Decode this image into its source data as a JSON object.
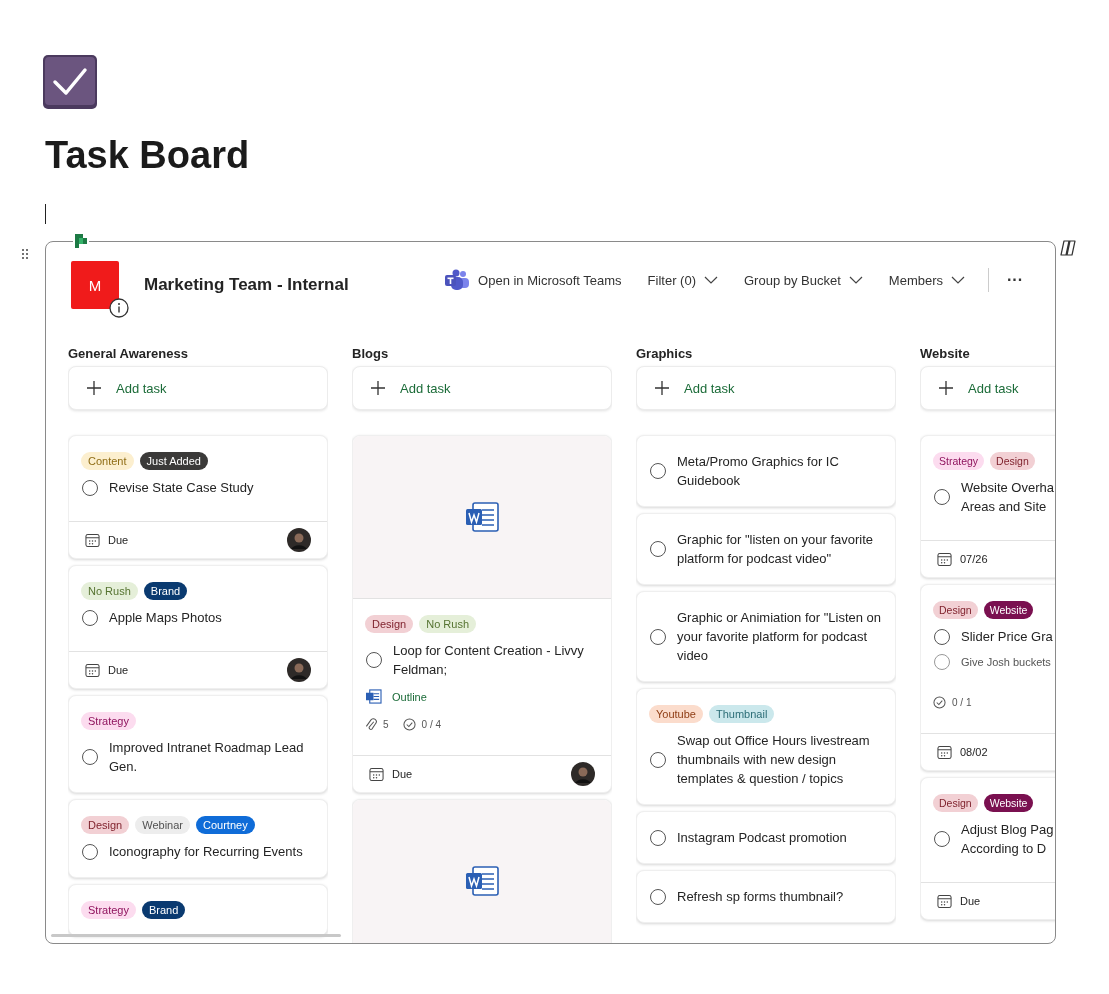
{
  "page": {
    "title": "Task Board"
  },
  "board": {
    "plan_initial": "M",
    "plan_name": "Marketing Team - Internal",
    "toolbar": [
      {
        "kind": "teams",
        "label": "Open in Microsoft Teams"
      },
      {
        "kind": "dropdown",
        "label": "Filter (0)"
      },
      {
        "kind": "dropdown",
        "label": "Group by Bucket"
      },
      {
        "kind": "dropdown",
        "label": "Members"
      }
    ],
    "more": "···",
    "columns": [
      {
        "name": "General Awareness",
        "add_label": "Add task",
        "cards": [
          {
            "tags": [
              {
                "label": "Content",
                "color": "#fcefcf"
              },
              {
                "label": "Just Added",
                "color": "#3b3a39"
              }
            ],
            "title": "Revise State Case Study",
            "done": false,
            "due": "Due",
            "assigned": true
          },
          {
            "tags": [
              {
                "label": "No Rush",
                "color": "#e5efd9"
              },
              {
                "label": "Brand",
                "color": "#0a3a70"
              }
            ],
            "title": "Apple Maps Photos",
            "done": false,
            "due": "Due",
            "assigned": true
          },
          {
            "tags": [
              {
                "label": "Strategy",
                "color": "#fcdcef"
              }
            ],
            "title": "Improved Intranet Roadmap Lead Gen.",
            "done": false
          },
          {
            "tags": [
              {
                "label": "Design",
                "color": "#f2d0d4"
              },
              {
                "label": "Webinar",
                "color": "#ededed"
              },
              {
                "label": "Courtney",
                "color": "#0f6cd8"
              }
            ],
            "title": "Iconography for Recurring Events",
            "done": false
          },
          {
            "tags": [
              {
                "label": "Strategy",
                "color": "#fcdcef"
              },
              {
                "label": "Brand",
                "color": "#0a3a70"
              }
            ]
          }
        ]
      },
      {
        "name": "Blogs",
        "add_label": "Add task",
        "cards": [
          {
            "preview": true,
            "tags": [
              {
                "label": "Design",
                "color": "#f2d0d4"
              },
              {
                "label": "No Rush",
                "color": "#e5efd9"
              }
            ],
            "title": "Loop for Content Creation - Livvy Feldman;",
            "done": false,
            "attachment": "Outline",
            "attachments_count": "5",
            "checklist_count": "0 / 4",
            "due": "Due",
            "assigned": true
          },
          {
            "preview": true
          }
        ]
      },
      {
        "name": "Graphics",
        "add_label": "Add task",
        "cards": [
          {
            "title": "Meta/Promo Graphics for IC Guidebook",
            "done": false
          },
          {
            "title": "Graphic for \"listen on your favorite platform for podcast video\"",
            "done": false
          },
          {
            "title": "Graphic or Animiation for \"Listen on your favorite platform for podcast video",
            "done": false
          },
          {
            "tags": [
              {
                "label": "Youtube",
                "color": "#fbdccc"
              },
              {
                "label": "Thumbnail",
                "color": "#cbe8ec"
              }
            ],
            "title": "Swap out Office Hours livestream thumbnails with new design templates & question / topics",
            "done": false
          },
          {
            "title": "Instagram Podcast promotion",
            "done": false
          },
          {
            "title": "Refresh sp forms thumbnail?",
            "done": false
          }
        ]
      },
      {
        "name": "Website",
        "add_label": "Add task",
        "cards": [
          {
            "tags": [
              {
                "label": "Strategy",
                "color": "#fcdcef"
              },
              {
                "label": "Design",
                "color": "#f2d0d4"
              }
            ],
            "title": "Website Overha\nAreas and Site",
            "done": false,
            "due": "07/26"
          },
          {
            "tags": [
              {
                "label": "Design",
                "color": "#f2d0d4"
              },
              {
                "label": "Website",
                "color": "#7a1050"
              }
            ],
            "title": "Slider Price Gra",
            "done": false,
            "checklist_items": [
              {
                "text": "Give Josh buckets",
                "checked": false
              }
            ],
            "checklist_count": "0 / 1",
            "due": "08/02"
          },
          {
            "tags": [
              {
                "label": "Design",
                "color": "#f2d0d4"
              },
              {
                "label": "Website",
                "color": "#7a1050"
              }
            ],
            "title": "Adjust Blog Pag\nAccording to D",
            "done": false,
            "due": "Due"
          }
        ]
      }
    ]
  }
}
